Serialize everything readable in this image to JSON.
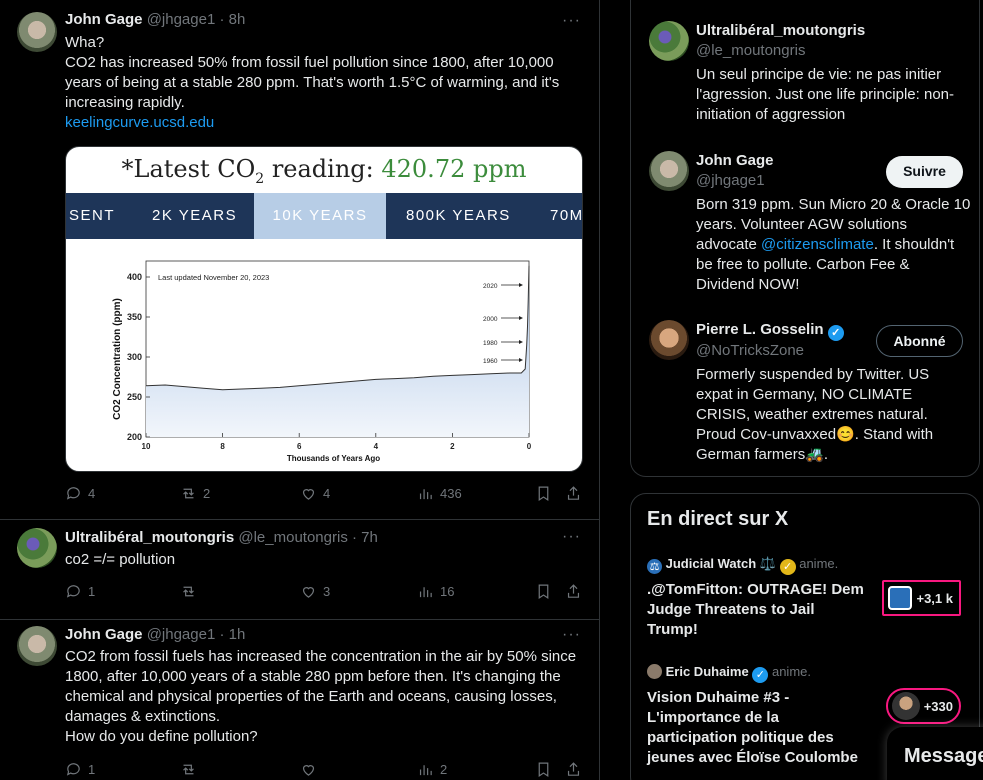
{
  "tweets": [
    {
      "name": "John Gage",
      "handle": "@jhgage1",
      "time": "8h",
      "text": "Wha?\nCO2 has increased 50% from fossil fuel pollution since 1800, after 10,000 years of being at a stable 280 ppm. That's worth 1.5°C of warming, and it's increasing rapidly.",
      "link": "keelingcurve.ucsd.edu",
      "replies": "4",
      "retweets": "2",
      "likes": "4",
      "views": "436"
    },
    {
      "name": "Ultralibéral_moutongris",
      "handle": "@le_moutongris",
      "time": "7h",
      "text": "co2 =/= pollution",
      "replies": "1",
      "retweets": "",
      "likes": "3",
      "views": "16"
    },
    {
      "name": "John Gage",
      "handle": "@jhgage1",
      "time": "1h",
      "text": "CO2 from fossil fuels has increased the concentration in the air by 50% since 1800, after 10,000 years of a stable 280 ppm before then. It's changing the chemical and physical properties of the Earth and oceans, causing losses, damages & extinctions.\nHow do you define pollution?",
      "replies": "1",
      "retweets": "",
      "likes": "",
      "views": "2"
    }
  ],
  "media": {
    "header_prefix": "*Latest CO",
    "header_sub": "2",
    "header_mid": " reading: ",
    "header_value": "420.72 ppm",
    "tabs": [
      "SENT",
      "2K YEARS",
      "10K YEARS",
      "800K YEARS",
      "70M"
    ],
    "selected_tab": "10K YEARS"
  },
  "chart_data": {
    "type": "area",
    "title": "",
    "annotation": "Last updated November 20, 2023",
    "xlabel": "Thousands of Years Ago",
    "ylabel": "CO2 Concentration (ppm)",
    "x_ticks": [
      "10",
      "8",
      "6",
      "4",
      "2",
      "0"
    ],
    "y_ticks": [
      "200",
      "250",
      "300",
      "350",
      "400"
    ],
    "xlim": [
      10,
      0
    ],
    "ylim": [
      200,
      420
    ],
    "markers": [
      "2020",
      "2000",
      "1980",
      "1960"
    ],
    "x": [
      10,
      9.5,
      9,
      8.5,
      8,
      7.5,
      7,
      6.5,
      6,
      5.5,
      5,
      4.5,
      4,
      3.5,
      3,
      2.5,
      2,
      1.5,
      1,
      0.5,
      0.2,
      0.1,
      0.06,
      0.04,
      0.02,
      0
    ],
    "values": [
      264,
      265,
      263,
      261,
      259,
      260,
      261,
      262,
      264,
      266,
      268,
      270,
      272,
      273,
      274,
      276,
      277,
      278,
      279,
      280,
      280,
      285,
      315,
      338,
      370,
      414
    ]
  },
  "right": {
    "people": [
      {
        "name": "Ultralibéral_moutongris",
        "handle": "@le_moutongris",
        "bio": "Un seul principe de vie: ne pas initier l'agression. Just one life principle: non-initiation of aggression"
      },
      {
        "name": "John Gage",
        "handle": "@jhgage1",
        "button": "Suivre",
        "bio_1": "Born 319 ppm. Sun Micro 20 & Oracle 10 years. Volunteer AGW solutions advocate ",
        "bio_mention": "@citizensclimate",
        "bio_2": ". It shouldn't be free to pollute. Carbon Fee & Dividend NOW!"
      },
      {
        "name": "Pierre L. Gosselin",
        "handle": "@NoTricksZone",
        "button": "Abonné",
        "bio": "Formerly suspended by Twitter. US expat in Germany, NO CLIMATE CRISIS, weather extremes natural. Proud Cov-unvaxxed😊. Stand with German farmers🚜."
      }
    ],
    "live": {
      "heading": "En direct sur X",
      "items": [
        {
          "source": "Judicial Watch ⚖️",
          "suffix": "anime.",
          "title": ".@TomFitton: OUTRAGE! Dem Judge Threatens to Jail Trump!",
          "count": "+3,1 k"
        },
        {
          "source": "Eric Duhaime",
          "suffix": "anime.",
          "title": "Vision Duhaime #3 - L'importance de la participation politique des jeunes avec Éloïse Coulombe",
          "count": "+330"
        }
      ]
    },
    "messages": "Message"
  },
  "colors": {
    "accent": "#1d9bf0",
    "live": "#f91880",
    "co2_value": "#3c8c3c",
    "tab_bar": "#1e3558"
  }
}
